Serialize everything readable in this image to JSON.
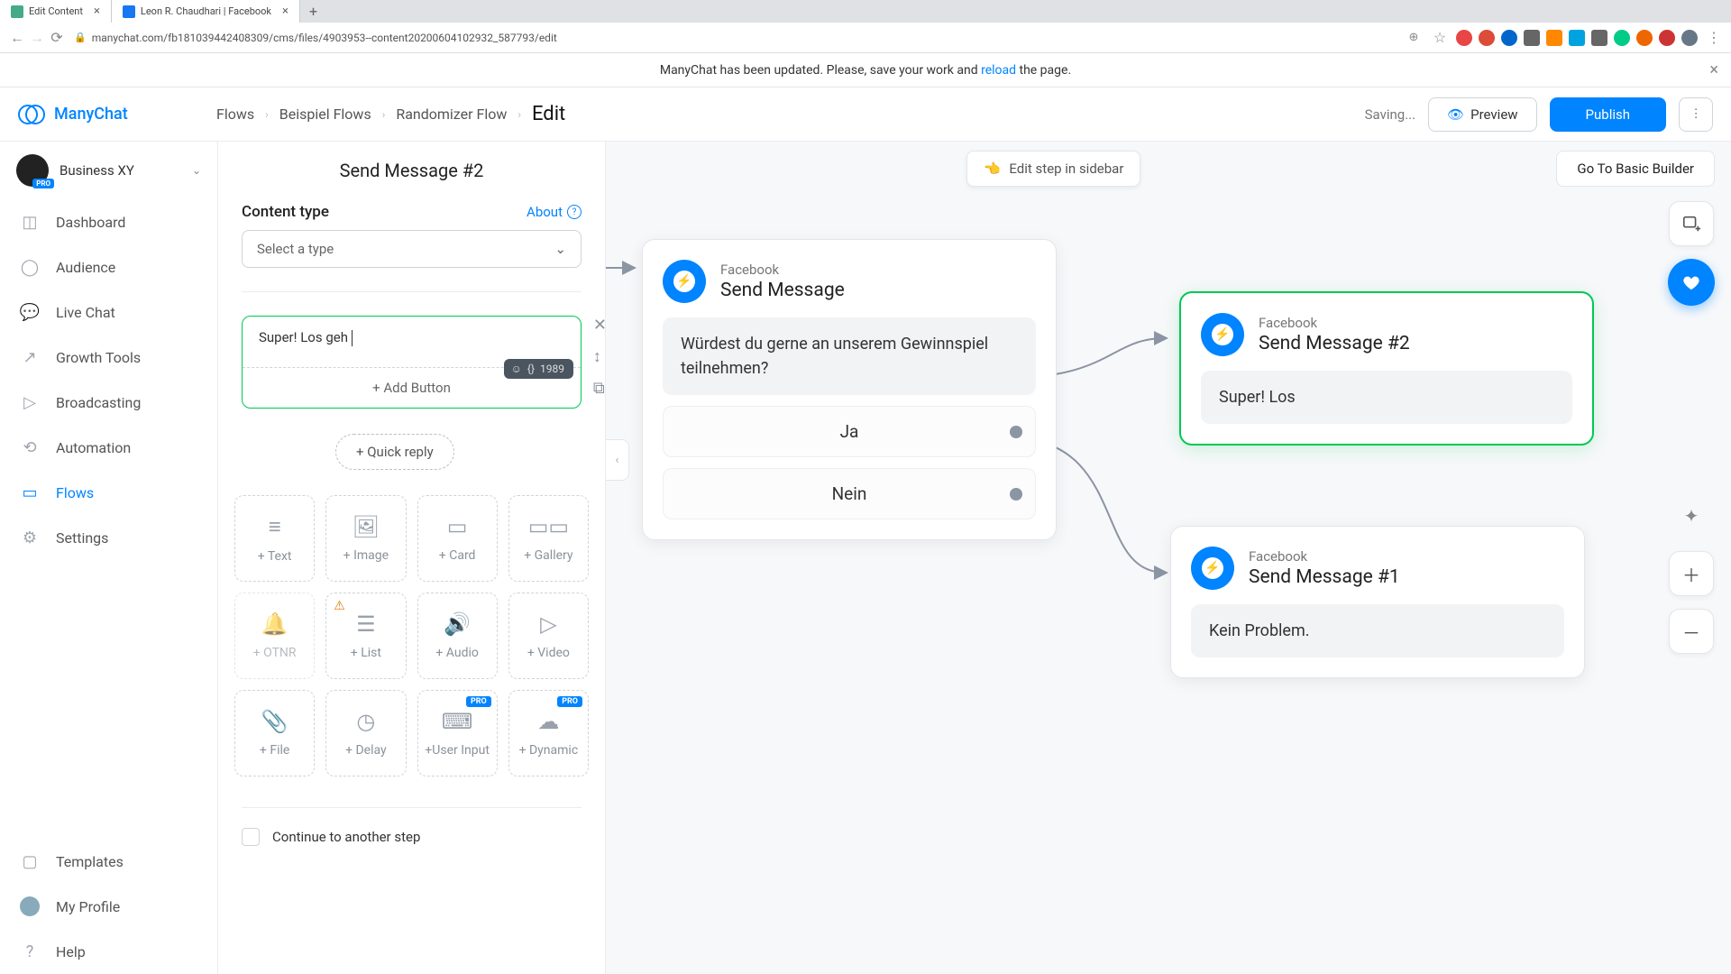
{
  "browser": {
    "tabs": [
      {
        "title": "Edit Content"
      },
      {
        "title": "Leon R. Chaudhari | Facebook"
      }
    ],
    "url": "manychat.com/fb181039442408309/cms/files/4903953--content20200604102932_587793/edit"
  },
  "notification": {
    "text_before": "ManyChat has been updated. Please, save your work and ",
    "link": "reload",
    "text_after": " the page."
  },
  "header": {
    "app_name": "ManyChat",
    "breadcrumbs": [
      "Flows",
      "Beispiel Flows",
      "Randomizer Flow"
    ],
    "current": "Edit",
    "saving": "Saving...",
    "preview": "Preview",
    "publish": "Publish"
  },
  "workspace": {
    "name": "Business XY",
    "badge": "PRO"
  },
  "nav": {
    "dashboard": "Dashboard",
    "audience": "Audience",
    "livechat": "Live Chat",
    "growth": "Growth Tools",
    "broadcasting": "Broadcasting",
    "automation": "Automation",
    "flows": "Flows",
    "settings": "Settings",
    "templates": "Templates",
    "profile": "My Profile",
    "help": "Help"
  },
  "editor": {
    "title": "Send Message #2",
    "content_type_label": "Content type",
    "about": "About",
    "select_placeholder": "Select a type",
    "text_value": "Super! Los geh",
    "char_count": "1989",
    "add_button": "+ Add Button",
    "quick_reply": "+ Quick reply",
    "continue_label": "Continue to another step"
  },
  "blocks": {
    "text": "+ Text",
    "image": "+ Image",
    "card": "+ Card",
    "gallery": "+ Gallery",
    "otnr": "+ OTNR",
    "list": "+ List",
    "audio": "+ Audio",
    "video": "+ Video",
    "file": "+ File",
    "delay": "+ Delay",
    "user_input": "+User Input",
    "dynamic": "+ Dynamic",
    "pro_badge": "PRO"
  },
  "canvas": {
    "hint": "Edit step in sidebar",
    "goto_basic": "Go To Basic Builder",
    "node1": {
      "platform": "Facebook",
      "title": "Send Message",
      "body": "Würdest du gerne an unserem Gewinnspiel teilnehmen?",
      "btn1": "Ja",
      "btn2": "Nein"
    },
    "node2": {
      "platform": "Facebook",
      "title": "Send Message #2",
      "body": "Super! Los"
    },
    "node3": {
      "platform": "Facebook",
      "title": "Send Message #1",
      "body": "Kein Problem."
    }
  }
}
